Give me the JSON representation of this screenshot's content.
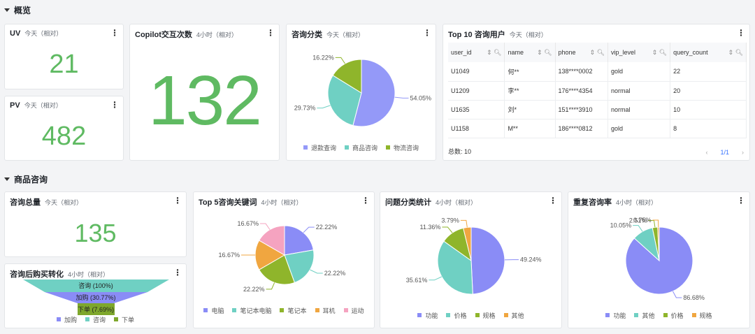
{
  "sections": {
    "overview": "概览",
    "product": "商品咨询"
  },
  "cards": {
    "uv": {
      "title": "UV",
      "range": "今天（相对）",
      "value": "21"
    },
    "pv": {
      "title": "PV",
      "range": "今天（相对）",
      "value": "482"
    },
    "copilot": {
      "title": "Copilot交互次数",
      "range": "4小时（相对）",
      "value": "132"
    },
    "total": {
      "title": "咨询总量",
      "range": "今天（相对）",
      "value": "135"
    },
    "top10": {
      "title": "Top 10 咨询用户",
      "range": "今天（相对）",
      "columns": [
        "user_id",
        "name",
        "phone",
        "vip_level",
        "query_count"
      ],
      "rows": [
        [
          "U1049",
          "何**",
          "138****0002",
          "gold",
          "22"
        ],
        [
          "U1209",
          "李**",
          "176****4354",
          "normal",
          "20"
        ],
        [
          "U1635",
          "刘*",
          "151****3910",
          "normal",
          "10"
        ],
        [
          "U1158",
          "M**",
          "186****0812",
          "gold",
          "8"
        ]
      ],
      "total_label": "总数: 10",
      "page": "1/1",
      "prev": "‹",
      "next": "›"
    },
    "funnel": {
      "title": "咨询后购买转化",
      "range": "4小时（相对）",
      "stages": [
        {
          "label": "咨询 (100%)",
          "color": "#6fd0c3"
        },
        {
          "label": "加购 (30.77%)",
          "color": "#8a8cf6"
        },
        {
          "label": "下单 (7.69%)",
          "color": "#7ea72c"
        }
      ],
      "legend": [
        {
          "label": "加购",
          "color": "#8a8cf6"
        },
        {
          "label": "咨询",
          "color": "#6fd0c3"
        },
        {
          "label": "下单",
          "color": "#7ea72c"
        }
      ]
    }
  },
  "chart_data": [
    {
      "id": "pie1",
      "type": "pie",
      "title": "咨询分类",
      "range": "今天（相对）",
      "categories": [
        "退款查询",
        "商品咨询",
        "物流咨询"
      ],
      "values": [
        54.05,
        29.73,
        16.22
      ],
      "labels": [
        "54.05%",
        "29.73%",
        "16.22%"
      ],
      "colors": [
        "#9499f8",
        "#6fd0c3",
        "#8fb52b"
      ]
    },
    {
      "id": "pie2",
      "type": "pie",
      "title": "Top 5咨询关键词",
      "range": "4小时（相对）",
      "categories": [
        "电脑",
        "笔记本电脑",
        "笔记本",
        "耳机",
        "运动"
      ],
      "values": [
        22.22,
        22.22,
        22.22,
        16.67,
        16.67
      ],
      "labels": [
        "22.22%",
        "22.22%",
        "22.22%",
        "16.67%",
        "16.67%"
      ],
      "colors": [
        "#8a8cf6",
        "#6fd0c3",
        "#8fb52b",
        "#f0a640",
        "#f5a3c0"
      ]
    },
    {
      "id": "pie3",
      "type": "pie",
      "title": "问题分类统计",
      "range": "4小时（相对）",
      "categories": [
        "功能",
        "价格",
        "规格",
        "其他"
      ],
      "values": [
        49.24,
        35.61,
        11.36,
        3.79
      ],
      "labels": [
        "49.24%",
        "35.61%",
        "11.36%",
        "3.79%"
      ],
      "colors": [
        "#8a8cf6",
        "#6fd0c3",
        "#8fb52b",
        "#f0a640"
      ]
    },
    {
      "id": "pie4",
      "type": "pie",
      "title": "重复咨询率",
      "range": "4小时（相对）",
      "categories": [
        "功能",
        "其他",
        "价格",
        "规格"
      ],
      "values": [
        86.68,
        10.05,
        2.51,
        0.75
      ],
      "labels": [
        "86.68%",
        "10.05%",
        "2.51%",
        "0.75%"
      ],
      "colors": [
        "#8a8cf6",
        "#6fd0c3",
        "#8fb52b",
        "#f0a640"
      ]
    }
  ]
}
